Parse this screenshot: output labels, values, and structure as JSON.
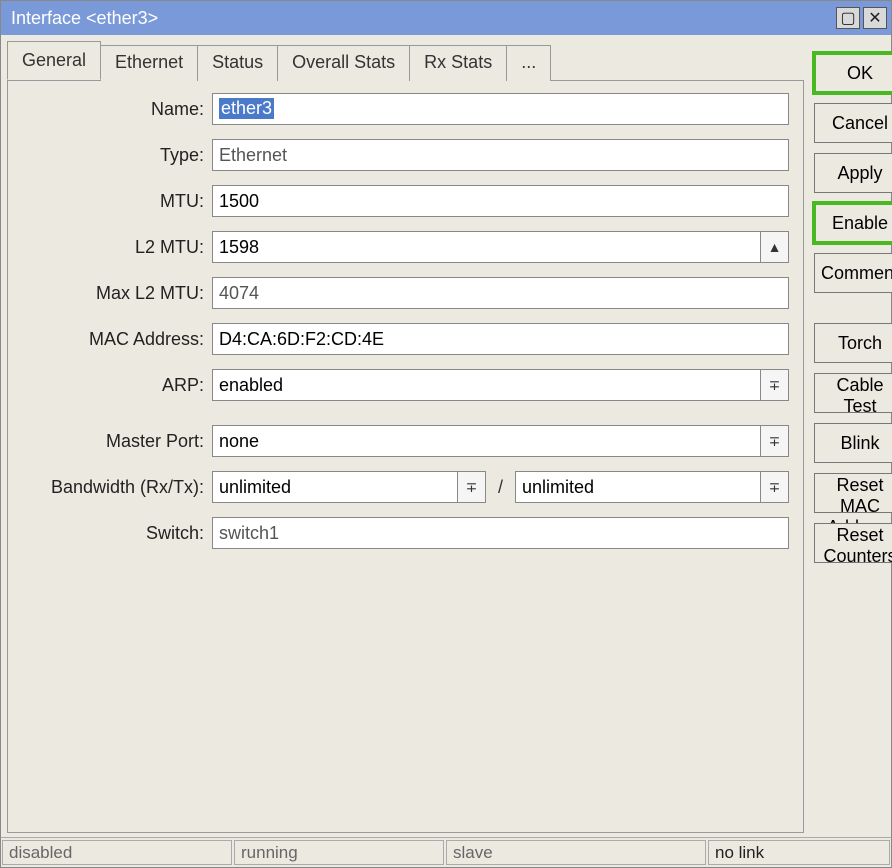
{
  "window": {
    "title": "Interface <ether3>"
  },
  "tabs": {
    "items": [
      {
        "label": "General"
      },
      {
        "label": "Ethernet"
      },
      {
        "label": "Status"
      },
      {
        "label": "Overall Stats"
      },
      {
        "label": "Rx Stats"
      },
      {
        "label": "..."
      }
    ]
  },
  "form": {
    "name_label": "Name:",
    "name_value": "ether3",
    "type_label": "Type:",
    "type_value": "Ethernet",
    "mtu_label": "MTU:",
    "mtu_value": "1500",
    "l2mtu_label": "L2 MTU:",
    "l2mtu_value": "1598",
    "maxl2mtu_label": "Max L2 MTU:",
    "maxl2mtu_value": "4074",
    "mac_label": "MAC Address:",
    "mac_value": "D4:CA:6D:F2:CD:4E",
    "arp_label": "ARP:",
    "arp_value": "enabled",
    "master_label": "Master Port:",
    "master_value": "none",
    "bw_label": "Bandwidth (Rx/Tx):",
    "bw_rx": "unlimited",
    "bw_tx": "unlimited",
    "switch_label": "Switch:",
    "switch_value": "switch1"
  },
  "buttons": {
    "ok": "OK",
    "cancel": "Cancel",
    "apply": "Apply",
    "enable": "Enable",
    "comment": "Comment",
    "torch": "Torch",
    "cable_test": "Cable Test",
    "blink": "Blink",
    "reset_mac": "Reset MAC Address",
    "reset_counters": "Reset Counters"
  },
  "status": {
    "disabled": "disabled",
    "running": "running",
    "slave": "slave",
    "nolink": "no link"
  }
}
